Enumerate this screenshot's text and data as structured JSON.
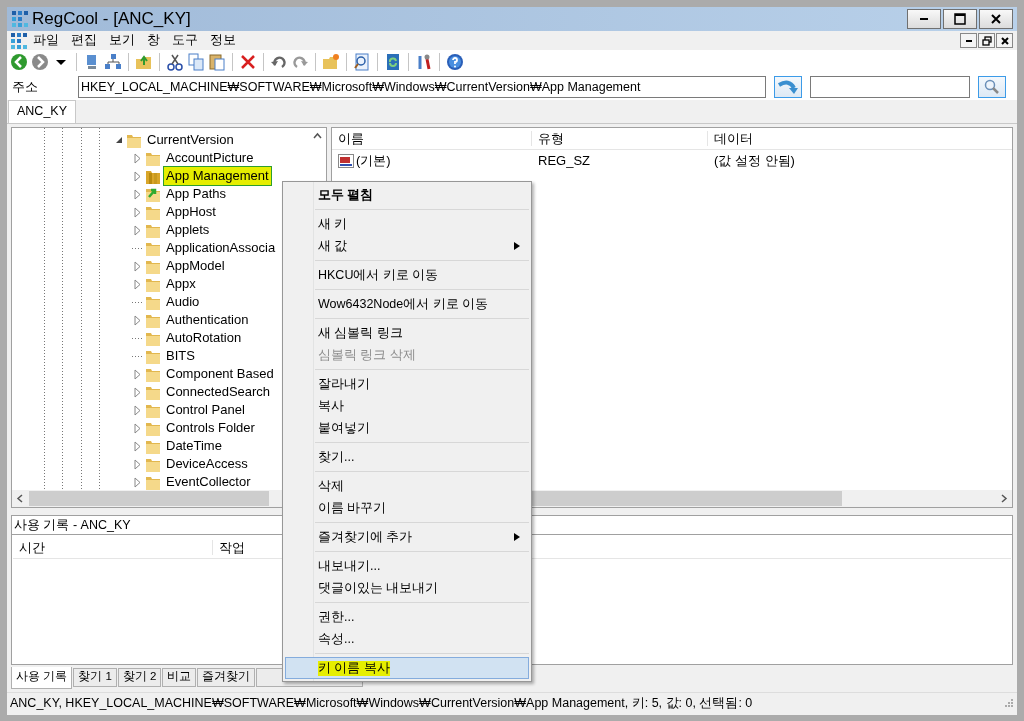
{
  "window": {
    "title": "RegCool - [ANC_KY]"
  },
  "menu": [
    "파일",
    "편집",
    "보기",
    "창",
    "도구",
    "정보"
  ],
  "address": {
    "label": "주소",
    "value": "HKEY_LOCAL_MACHINE₩SOFTWARE₩Microsoft₩Windows₩CurrentVersion₩App Management"
  },
  "document_tabs": [
    {
      "label": "ANC_KY",
      "selected": true
    }
  ],
  "tree": {
    "label": "CurrentVersion",
    "expanded": true,
    "children": [
      {
        "label": "AccountPicture",
        "kind": "folder",
        "expandable": true,
        "selected": false,
        "highlighted": false
      },
      {
        "label": "App Management",
        "kind": "open-folder",
        "expandable": true,
        "selected": true,
        "highlighted": true
      },
      {
        "label": "App Paths",
        "kind": "link",
        "expandable": true,
        "selected": false,
        "highlighted": false
      },
      {
        "label": "AppHost",
        "kind": "folder",
        "expandable": true,
        "selected": false,
        "highlighted": false
      },
      {
        "label": "Applets",
        "kind": "folder",
        "expandable": true,
        "selected": false,
        "highlighted": false
      },
      {
        "label": "ApplicationAssocia",
        "kind": "folder",
        "expandable": false,
        "selected": false,
        "highlighted": false
      },
      {
        "label": "AppModel",
        "kind": "folder",
        "expandable": true,
        "selected": false,
        "highlighted": false
      },
      {
        "label": "Appx",
        "kind": "folder",
        "expandable": true,
        "selected": false,
        "highlighted": false
      },
      {
        "label": "Audio",
        "kind": "folder",
        "expandable": false,
        "selected": false,
        "highlighted": false
      },
      {
        "label": "Authentication",
        "kind": "folder",
        "expandable": true,
        "selected": false,
        "highlighted": false
      },
      {
        "label": "AutoRotation",
        "kind": "folder",
        "expandable": false,
        "selected": false,
        "highlighted": false
      },
      {
        "label": "BITS",
        "kind": "folder",
        "expandable": false,
        "selected": false,
        "highlighted": false
      },
      {
        "label": "Component Based",
        "kind": "folder",
        "expandable": true,
        "selected": false,
        "highlighted": false
      },
      {
        "label": "ConnectedSearch",
        "kind": "folder",
        "expandable": true,
        "selected": false,
        "highlighted": false
      },
      {
        "label": "Control Panel",
        "kind": "folder",
        "expandable": true,
        "selected": false,
        "highlighted": false
      },
      {
        "label": "Controls Folder",
        "kind": "folder",
        "expandable": true,
        "selected": false,
        "highlighted": false
      },
      {
        "label": "DateTime",
        "kind": "folder",
        "expandable": true,
        "selected": false,
        "highlighted": false
      },
      {
        "label": "DeviceAccess",
        "kind": "folder",
        "expandable": true,
        "selected": false,
        "highlighted": false
      },
      {
        "label": "EventCollector",
        "kind": "folder",
        "expandable": true,
        "selected": false,
        "highlighted": false
      }
    ]
  },
  "values": {
    "columns": [
      "이름",
      "유형",
      "데이터"
    ],
    "rows": [
      {
        "name": "(기본)",
        "type": "REG_SZ",
        "data": "(값 설정 안됨)"
      }
    ]
  },
  "history": {
    "title": "사용 기록 - ANC_KY",
    "columns": [
      "시간",
      "작업"
    ]
  },
  "bottom_tabs": [
    {
      "label": "사용 기록",
      "selected": true
    },
    {
      "label": "찾기 1",
      "selected": false
    },
    {
      "label": "찾기 2",
      "selected": false
    },
    {
      "label": "비교",
      "selected": false
    },
    {
      "label": "즐겨찾기",
      "selected": false
    }
  ],
  "status_bar": "ANC_KY, HKEY_LOCAL_MACHINE₩SOFTWARE₩Microsoft₩Windows₩CurrentVersion₩App Management, 키: 5, 값: 0, 선택됨: 0",
  "context_menu": [
    {
      "kind": "item",
      "label": "모두 펼침",
      "bold": true,
      "disabled": false,
      "submenu": false,
      "selected": false,
      "highlighted": false
    },
    {
      "kind": "separator"
    },
    {
      "kind": "item",
      "label": "새 키",
      "bold": false,
      "disabled": false,
      "submenu": false,
      "selected": false,
      "highlighted": false
    },
    {
      "kind": "item",
      "label": "새 값",
      "bold": false,
      "disabled": false,
      "submenu": true,
      "selected": false,
      "highlighted": false
    },
    {
      "kind": "separator"
    },
    {
      "kind": "item",
      "label": "HKCU에서 키로 이동",
      "bold": false,
      "disabled": false,
      "submenu": false,
      "selected": false,
      "highlighted": false
    },
    {
      "kind": "separator"
    },
    {
      "kind": "item",
      "label": "Wow6432Node에서 키로 이동",
      "bold": false,
      "disabled": false,
      "submenu": false,
      "selected": false,
      "highlighted": false
    },
    {
      "kind": "separator"
    },
    {
      "kind": "item",
      "label": "새 심볼릭 링크",
      "bold": false,
      "disabled": false,
      "submenu": false,
      "selected": false,
      "highlighted": false
    },
    {
      "kind": "item",
      "label": "심볼릭 링크 삭제",
      "bold": false,
      "disabled": true,
      "submenu": false,
      "selected": false,
      "highlighted": false
    },
    {
      "kind": "separator"
    },
    {
      "kind": "item",
      "label": "잘라내기",
      "bold": false,
      "disabled": false,
      "submenu": false,
      "selected": false,
      "highlighted": false
    },
    {
      "kind": "item",
      "label": "복사",
      "bold": false,
      "disabled": false,
      "submenu": false,
      "selected": false,
      "highlighted": false
    },
    {
      "kind": "item",
      "label": "붙여넣기",
      "bold": false,
      "disabled": false,
      "submenu": false,
      "selected": false,
      "highlighted": false
    },
    {
      "kind": "separator"
    },
    {
      "kind": "item",
      "label": "찾기...",
      "bold": false,
      "disabled": false,
      "submenu": false,
      "selected": false,
      "highlighted": false
    },
    {
      "kind": "separator"
    },
    {
      "kind": "item",
      "label": "삭제",
      "bold": false,
      "disabled": false,
      "submenu": false,
      "selected": false,
      "highlighted": false
    },
    {
      "kind": "item",
      "label": "이름 바꾸기",
      "bold": false,
      "disabled": false,
      "submenu": false,
      "selected": false,
      "highlighted": false
    },
    {
      "kind": "separator"
    },
    {
      "kind": "item",
      "label": "즐겨찾기에 추가",
      "bold": false,
      "disabled": false,
      "submenu": true,
      "selected": false,
      "highlighted": false
    },
    {
      "kind": "separator"
    },
    {
      "kind": "item",
      "label": "내보내기...",
      "bold": false,
      "disabled": false,
      "submenu": false,
      "selected": false,
      "highlighted": false
    },
    {
      "kind": "item",
      "label": "댓글이있는 내보내기",
      "bold": false,
      "disabled": false,
      "submenu": false,
      "selected": false,
      "highlighted": false
    },
    {
      "kind": "separator"
    },
    {
      "kind": "item",
      "label": "권한...",
      "bold": false,
      "disabled": false,
      "submenu": false,
      "selected": false,
      "highlighted": false
    },
    {
      "kind": "item",
      "label": "속성...",
      "bold": false,
      "disabled": false,
      "submenu": false,
      "selected": false,
      "highlighted": false
    },
    {
      "kind": "separator"
    },
    {
      "kind": "item",
      "label": "키 이름 복사",
      "bold": false,
      "disabled": false,
      "submenu": false,
      "selected": true,
      "highlighted": true
    }
  ]
}
